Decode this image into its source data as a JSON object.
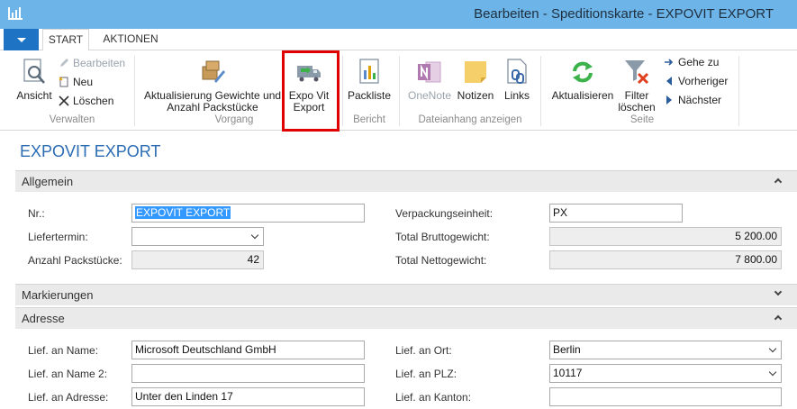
{
  "window": {
    "title": "Bearbeiten - Speditionskarte - EXPOVIT EXPORT"
  },
  "tabs": [
    {
      "label": "START"
    },
    {
      "label": "AKTIONEN"
    }
  ],
  "ribbon": {
    "verwalten": {
      "label": "Verwalten",
      "ansicht": "Ansicht",
      "bearbeiten": "Bearbeiten",
      "neu": "Neu",
      "loeschen": "Löschen"
    },
    "vorgang": {
      "label": "Vorgang",
      "aktualisierung_line1": "Aktualisierung Gewichte und",
      "aktualisierung_line2": "Anzahl Packstücke",
      "expo_line1": "Expo Vit",
      "expo_line2": "Export"
    },
    "bericht": {
      "label": "Bericht",
      "packliste": "Packliste"
    },
    "dateianhang": {
      "label": "Dateianhang anzeigen",
      "onenote": "OneNote",
      "notizen": "Notizen",
      "links": "Links"
    },
    "seite": {
      "label": "Seite",
      "aktualisieren": "Aktualisieren",
      "filter_line1": "Filter",
      "filter_line2": "löschen",
      "gehe_zu": "Gehe zu",
      "vorheriger": "Vorheriger",
      "naechster": "Nächster"
    }
  },
  "page": {
    "title": "EXPOVIT EXPORT"
  },
  "sections": {
    "allgemein": {
      "title": "Allgemein",
      "nr_label": "Nr.:",
      "nr_value": "EXPOVIT EXPORT",
      "liefertermin_label": "Liefertermin:",
      "liefertermin_value": "",
      "anzahl_label": "Anzahl Packstücke:",
      "anzahl_value": "42",
      "verpackung_label": "Verpackungseinheit:",
      "verpackung_value": "PX",
      "brutto_label": "Total Bruttogewicht:",
      "brutto_value": "5 200.00",
      "netto_label": "Total Nettogewicht:",
      "netto_value": "7 800.00"
    },
    "markierungen": {
      "title": "Markierungen"
    },
    "adresse": {
      "title": "Adresse",
      "name_label": "Lief. an Name:",
      "name_value": "Microsoft Deutschland GmbH",
      "name2_label": "Lief. an Name 2:",
      "name2_value": "",
      "adresse_label": "Lief. an Adresse:",
      "adresse_value": "Unter den Linden 17",
      "ort_label": "Lief. an Ort:",
      "ort_value": "Berlin",
      "plz_label": "Lief. an PLZ:",
      "plz_value": "10117",
      "kanton_label": "Lief. an Kanton:",
      "kanton_value": ""
    }
  },
  "colors": {
    "titlebar": "#6db5e8",
    "accent": "#1f73c4",
    "page_title": "#2b6cb3",
    "highlight": "#e00000"
  }
}
